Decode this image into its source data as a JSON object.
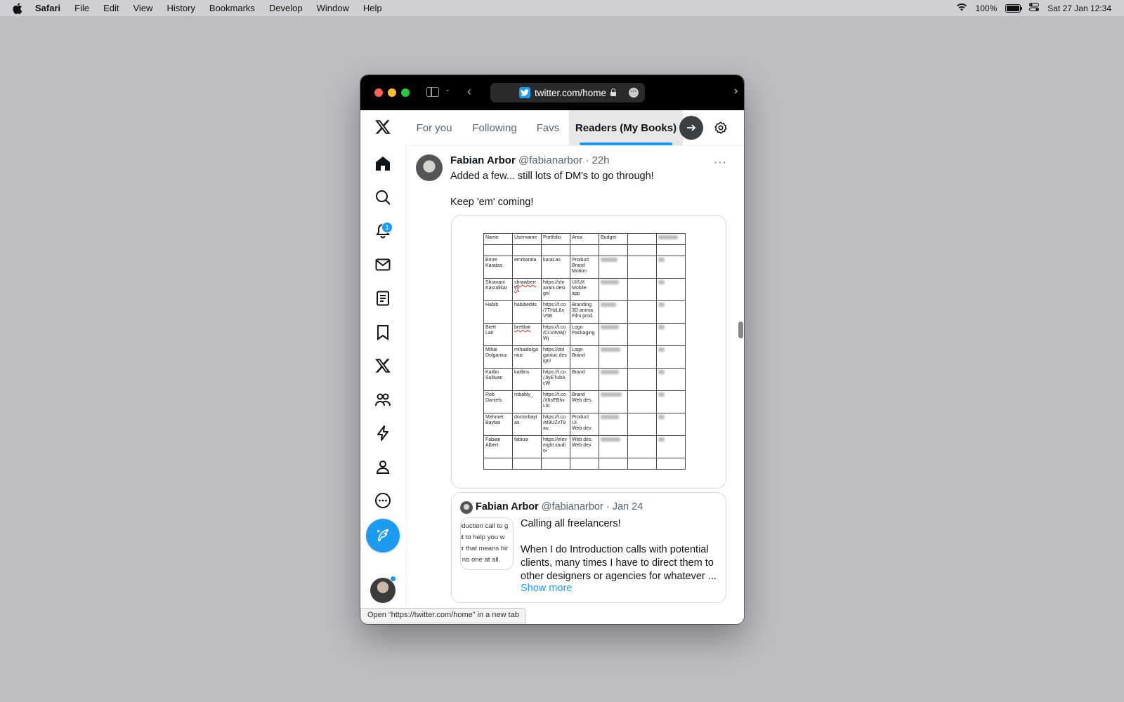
{
  "menubar": {
    "app_name": "Safari",
    "menus": [
      "File",
      "Edit",
      "View",
      "History",
      "Bookmarks",
      "Develop",
      "Window",
      "Help"
    ],
    "battery": "100%",
    "datetime": "Sat 27 Jan  12:34"
  },
  "browser": {
    "url": "twitter.com/home",
    "status_tooltip": "Open “https://twitter.com/home” in a new tab"
  },
  "nav": {
    "notification_count": "1",
    "icons": [
      "x-logo-icon",
      "home-icon",
      "search-icon",
      "bell-icon",
      "mail-icon",
      "lists-icon",
      "bookmark-icon",
      "x-premium-icon",
      "communities-icon",
      "lightning-icon",
      "profile-icon",
      "more-icon",
      "compose-icon"
    ]
  },
  "tabs": {
    "items": [
      "For you",
      "Following",
      "Favs",
      "Readers (My Books)"
    ],
    "overflow_fragment": "\\",
    "active": "Readers (My Books)"
  },
  "tweet": {
    "author": "Fabian Arbor",
    "handle": "@fabianarbor",
    "time": "22h",
    "text_line1": "Added a few... still lots of DM's to go through!",
    "text_line2": "Keep 'em' coming!"
  },
  "spreadsheet": {
    "headers": [
      "Name",
      "Username",
      "Portfolio",
      "Area",
      "Budget",
      "",
      ""
    ],
    "rows": [
      [
        "Emre\nKaratas",
        "emrkarata",
        "karat.as",
        "Product\nBrand\nMotion"
      ],
      [
        "Shravani\nKasralikar",
        "shrawberr\nyy",
        "https://shr\navani.desi\ngn/",
        "UI/UX\nMobile\napp"
      ],
      [
        "Habib",
        "habibedits",
        "https://t.co\n/7THzL6x\nV5B",
        "Branding\n3D anima\nFilm prod."
      ],
      [
        "Brett\nLair",
        "brettlair",
        "https://t.co\n/CLV3vWjr\nWj",
        "Logo\nPackaging"
      ],
      [
        "Mihai\nDolganiuc",
        "mihaidolga\nniuc",
        "https://dol\nganiuc.des\nign/",
        "Logo\nBrand"
      ],
      [
        "Kaitlin\nSullivan",
        "kaitlins",
        "https://t.co\n/JiyETubA\ncW",
        "Brand"
      ],
      [
        "Rob\nDaniels",
        "robably_",
        "https://t.co\n/X6sEBhx\nLlo",
        "Brand\nWeb des."
      ],
      [
        "Mehmet\nBaytas",
        "doctorbayt\nas",
        "https://t.co\n/el9UZvT9\nau",
        "Product\nUI\nWeb dev."
      ],
      [
        "Fabian\nAlbert",
        "fabiuix",
        "https://elev\neight.studi\no/",
        "Web des.\nWeb dev."
      ]
    ]
  },
  "quote": {
    "author": "Fabian Arbor",
    "handle": "@fabianarbor",
    "time": "Jan 24",
    "thumb_lines": [
      "oduction call to g",
      "nt to help you w",
      "er that means hir",
      "r no one at all."
    ],
    "text_line1": "Calling all freelancers!",
    "text_line2": "When I do Introduction calls with potential clients, many times I have to direct them to other designers or agencies for whatever ...",
    "show_more": "Show more"
  },
  "colors": {
    "accent": "#1d9bf0",
    "text": "#0f1419",
    "secondary_text": "#536471"
  }
}
